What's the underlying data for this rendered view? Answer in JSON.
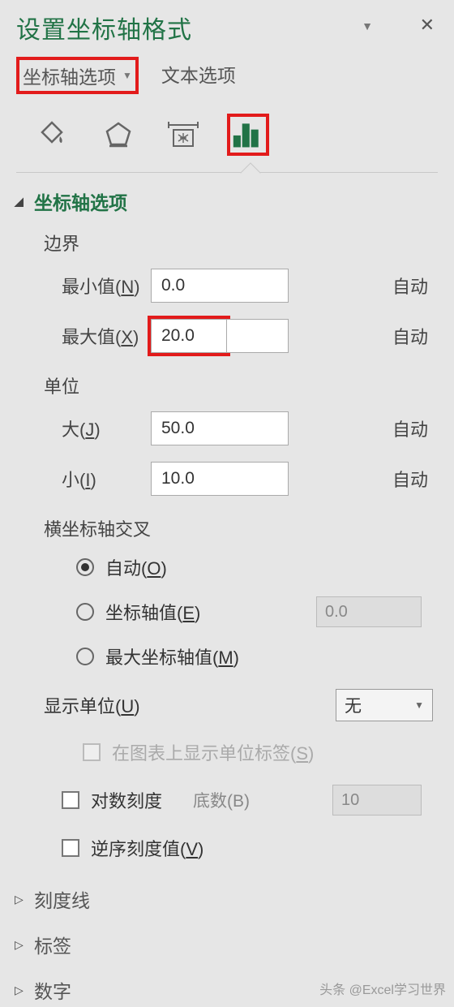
{
  "title": "设置坐标轴格式",
  "tabs": {
    "axis_options": "坐标轴选项",
    "text_options": "文本选项"
  },
  "icons": {
    "fill": "fill-icon",
    "effects": "effects-icon",
    "size": "size-icon",
    "chart": "chart-icon"
  },
  "section_axis_options": "坐标轴选项",
  "bounds": {
    "label": "边界",
    "min_label": "最小值(N)",
    "min_value": "0.0",
    "min_suffix": "自动",
    "max_label": "最大值(X)",
    "max_value": "20.0",
    "max_suffix": "自动"
  },
  "units": {
    "label": "单位",
    "major_label": "大(J)",
    "major_value": "50.0",
    "major_suffix": "自动",
    "minor_label": "小(I)",
    "minor_value": "10.0",
    "minor_suffix": "自动"
  },
  "cross": {
    "label": "横坐标轴交叉",
    "auto": "自动(O)",
    "value": "坐标轴值(E)",
    "value_input": "0.0",
    "max": "最大坐标轴值(M)"
  },
  "display_units": {
    "label": "显示单位(U)",
    "selected": "无",
    "show_label": "在图表上显示单位标签(S)"
  },
  "log_scale": {
    "label": "对数刻度",
    "base_label": "底数(B)",
    "base_value": "10"
  },
  "reverse": "逆序刻度值(V)",
  "collapsed_sections": {
    "ticks": "刻度线",
    "labels": "标签",
    "number": "数字"
  },
  "watermark": "头条 @Excel学习世界"
}
